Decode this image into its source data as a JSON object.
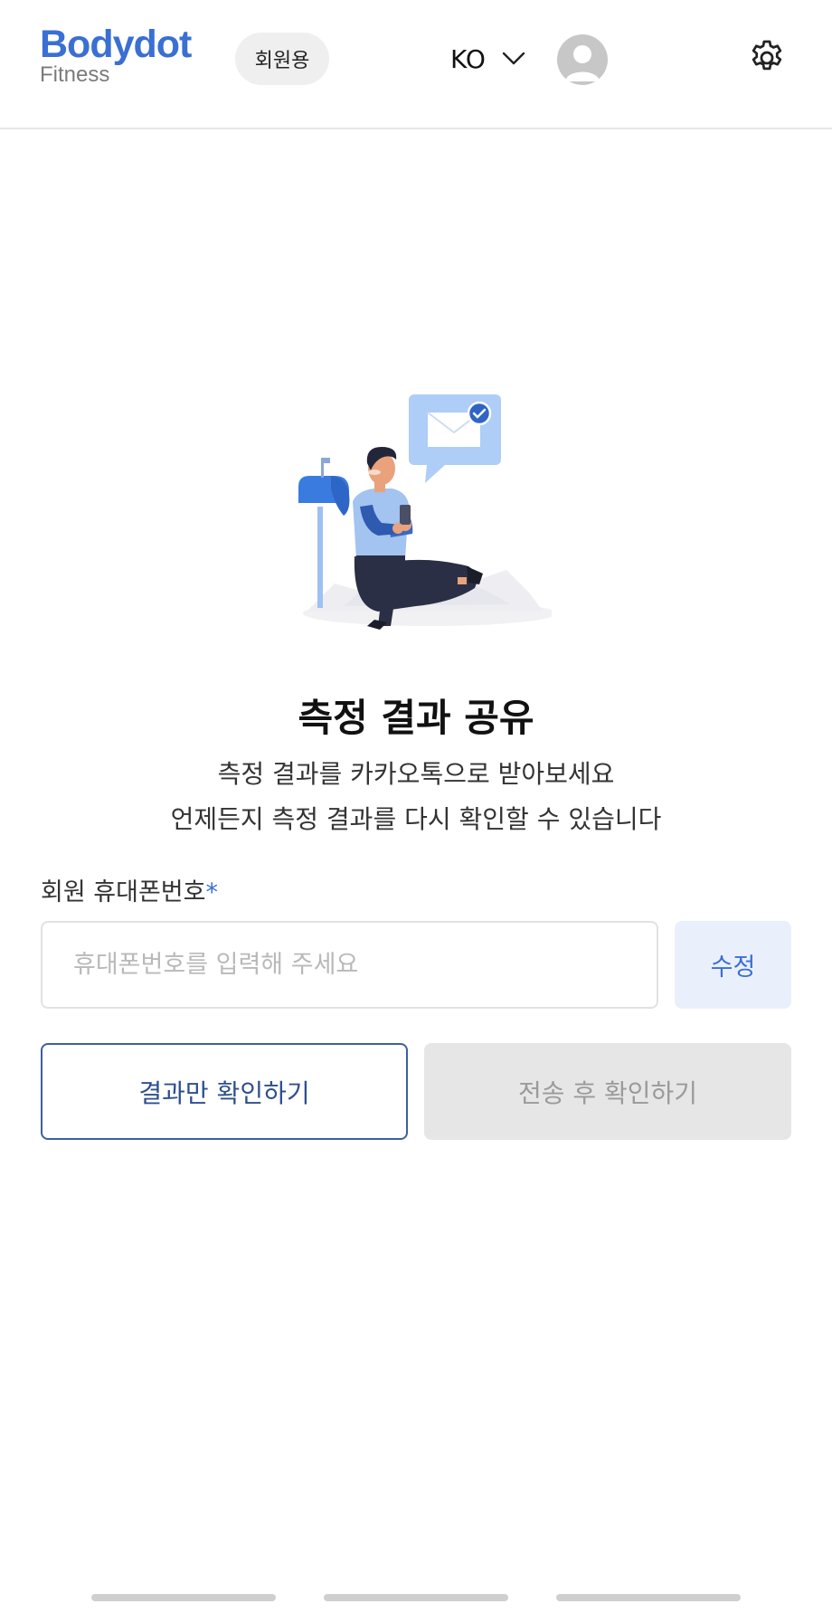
{
  "header": {
    "logo_main": "Bodydot",
    "logo_sub": "Fitness",
    "member_badge": "회원용",
    "language": "KO"
  },
  "main": {
    "title": "측정 결과 공유",
    "description_line1": "측정 결과를 카카오톡으로 받아보세요",
    "description_line2": "언제든지 측정 결과를 다시 확인할 수 있습니다",
    "phone_label": "회원 휴대폰번호",
    "required_mark": "*",
    "phone_placeholder": "휴대폰번호를 입력해 주세요",
    "phone_value": "",
    "edit_button": "수정",
    "view_result_button": "결과만 확인하기",
    "send_and_view_button": "전송 후 확인하기"
  },
  "colors": {
    "brand": "#3a6fd3",
    "outline_button": "#3e5f9e",
    "disabled_button_bg": "#e6e6e6"
  },
  "icons": [
    "chevron-down-icon",
    "avatar-icon",
    "gear-icon",
    "share-illustration"
  ]
}
